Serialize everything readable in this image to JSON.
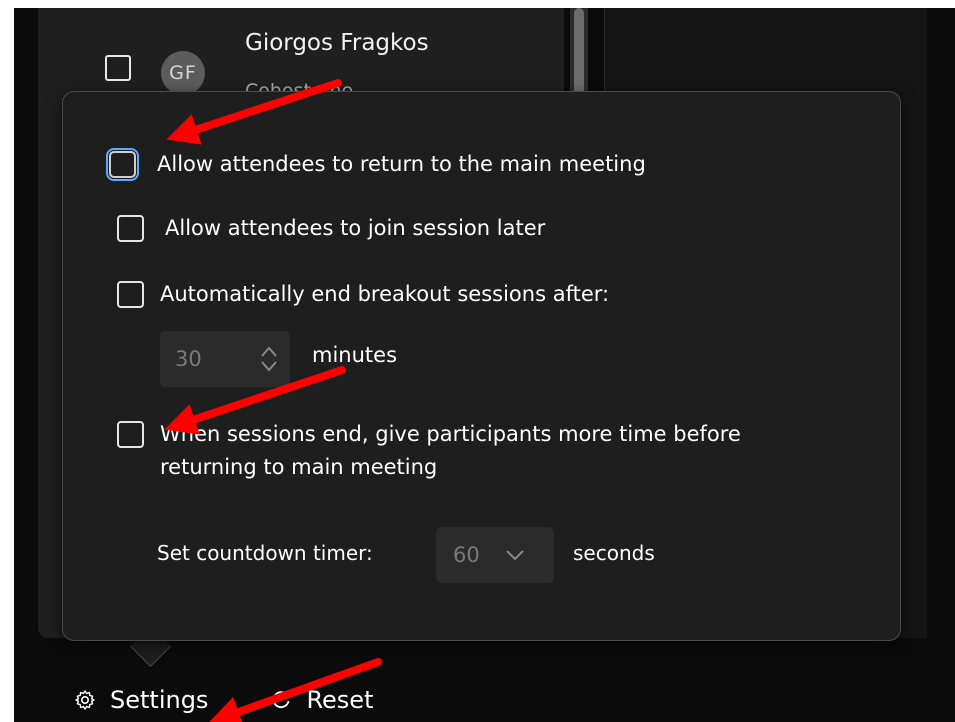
{
  "participant": {
    "initials": "GF",
    "name": "Giorgos Fragkos",
    "subtitle": "Cohost, me"
  },
  "settings_popup": {
    "options": [
      {
        "label": "Allow attendees to return to the main meeting",
        "checked": false
      },
      {
        "label": "Allow attendees to join session later",
        "checked": false
      },
      {
        "label": "Automatically end breakout sessions after:",
        "checked": false
      },
      {
        "label": "When sessions end, give participants more time before returning to main meeting",
        "checked": false
      }
    ],
    "auto_end": {
      "value": "30",
      "unit": "minutes"
    },
    "countdown": {
      "label": "Set countdown timer:",
      "value": "60",
      "unit": "seconds"
    }
  },
  "toolbar": {
    "settings_label": "Settings",
    "reset_label": "Reset"
  },
  "icons": [
    "gear-icon",
    "reset-icon",
    "spin-up-icon",
    "spin-down-icon",
    "chevron-down-icon"
  ],
  "colors": {
    "popup_bg": "#1e1e1e",
    "app_bg": "#0b0b0b",
    "focus_ring": "#5fa8ff",
    "annotation_arrow": "#ff0000"
  }
}
